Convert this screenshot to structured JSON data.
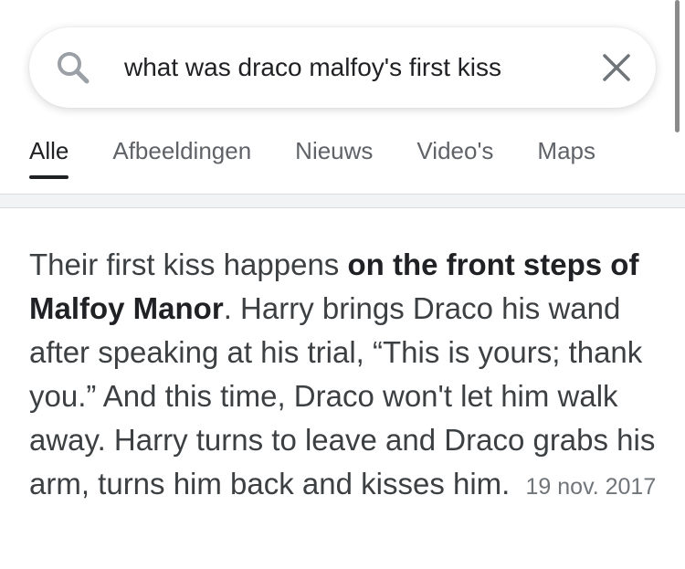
{
  "search": {
    "query": "what was draco malfoy's first kiss",
    "search_icon": "search-icon",
    "clear_icon": "close-icon"
  },
  "tabs": [
    {
      "label": "Alle",
      "active": true
    },
    {
      "label": "Afbeeldingen"
    },
    {
      "label": "Nieuws"
    },
    {
      "label": "Video's"
    },
    {
      "label": "Maps"
    }
  ],
  "snippet": {
    "text_before": "Their first kiss happens ",
    "highlight": "on the front steps of Malfoy Manor",
    "text_after": ". Harry brings Draco his wand after speaking at his trial, “This is yours; thank you.” And this time, Draco won't let him walk away. Harry turns to leave and Draco grabs his arm, turns him back and kisses him.",
    "date": "19 nov. 2017"
  },
  "colors": {
    "text_primary": "#202124",
    "text_secondary": "#5f6368",
    "snippet_text": "#3c4043",
    "date_text": "#70757a"
  }
}
